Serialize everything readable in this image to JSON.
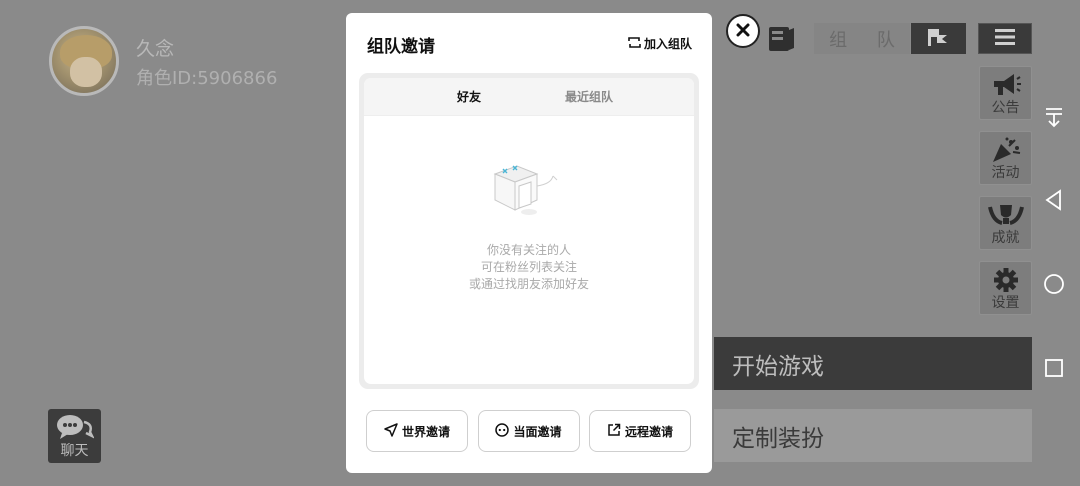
{
  "player": {
    "name": "久念",
    "id_label": "角色ID:5906866"
  },
  "chat": {
    "label": "聊天"
  },
  "top_bar": {
    "team_label": "组 队"
  },
  "side_menu": [
    {
      "label": "公告",
      "icon": "megaphone-icon"
    },
    {
      "label": "活动",
      "icon": "party-popper-icon"
    },
    {
      "label": "成就",
      "icon": "trophy-wreath-icon"
    },
    {
      "label": "设置",
      "icon": "gear-icon"
    }
  ],
  "actions": {
    "start_game": "开始游戏",
    "customize": "定制装扮"
  },
  "modal": {
    "title": "组队邀请",
    "join_team": "加入组队",
    "tabs": [
      {
        "label": "好友",
        "active": true
      },
      {
        "label": "最近组队",
        "active": false
      }
    ],
    "empty_lines": [
      "你没有关注的人",
      "可在粉丝列表关注",
      "或通过找朋友添加好友"
    ],
    "invite_buttons": [
      {
        "label": "世界邀请",
        "icon": "send-icon"
      },
      {
        "label": "当面邀请",
        "icon": "face-icon"
      },
      {
        "label": "远程邀请",
        "icon": "external-link-icon"
      }
    ]
  },
  "colors": {
    "overlay_bg": "#8a8a8a",
    "dark_button": "#3a3a3a",
    "modal_bg": "#ffffff",
    "panel_bg": "#ececec"
  }
}
